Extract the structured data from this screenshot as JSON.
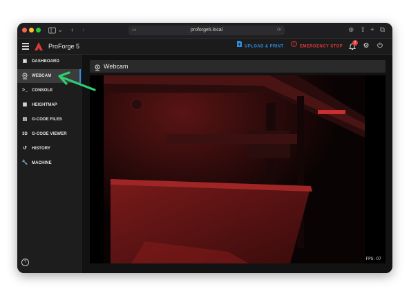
{
  "browser": {
    "url": "proforge5.local"
  },
  "app": {
    "title": "ProForge 5",
    "upload_label": "UPLOAD & PRINT",
    "estop_label": "EMERGENCY STOP",
    "notification_count": "2"
  },
  "sidebar": {
    "items": [
      {
        "label": "DASHBOARD",
        "icon": "dashboard-icon"
      },
      {
        "label": "WEBCAM",
        "icon": "webcam-icon",
        "active": true
      },
      {
        "label": "CONSOLE",
        "icon": "console-icon"
      },
      {
        "label": "HEIGHTMAP",
        "icon": "grid-icon"
      },
      {
        "label": "G-CODE FILES",
        "icon": "file-icon"
      },
      {
        "label": "G-CODE VIEWER",
        "icon": "3d-icon"
      },
      {
        "label": "HISTORY",
        "icon": "history-icon"
      },
      {
        "label": "MACHINE",
        "icon": "wrench-icon"
      }
    ],
    "viewer_icon_text": "3D"
  },
  "webcam": {
    "title": "Webcam",
    "fps": "FPS: 07"
  },
  "colors": {
    "accent_blue": "#2f8de4",
    "estop_red": "#e63a3a",
    "arrow_green": "#2ecf71"
  }
}
